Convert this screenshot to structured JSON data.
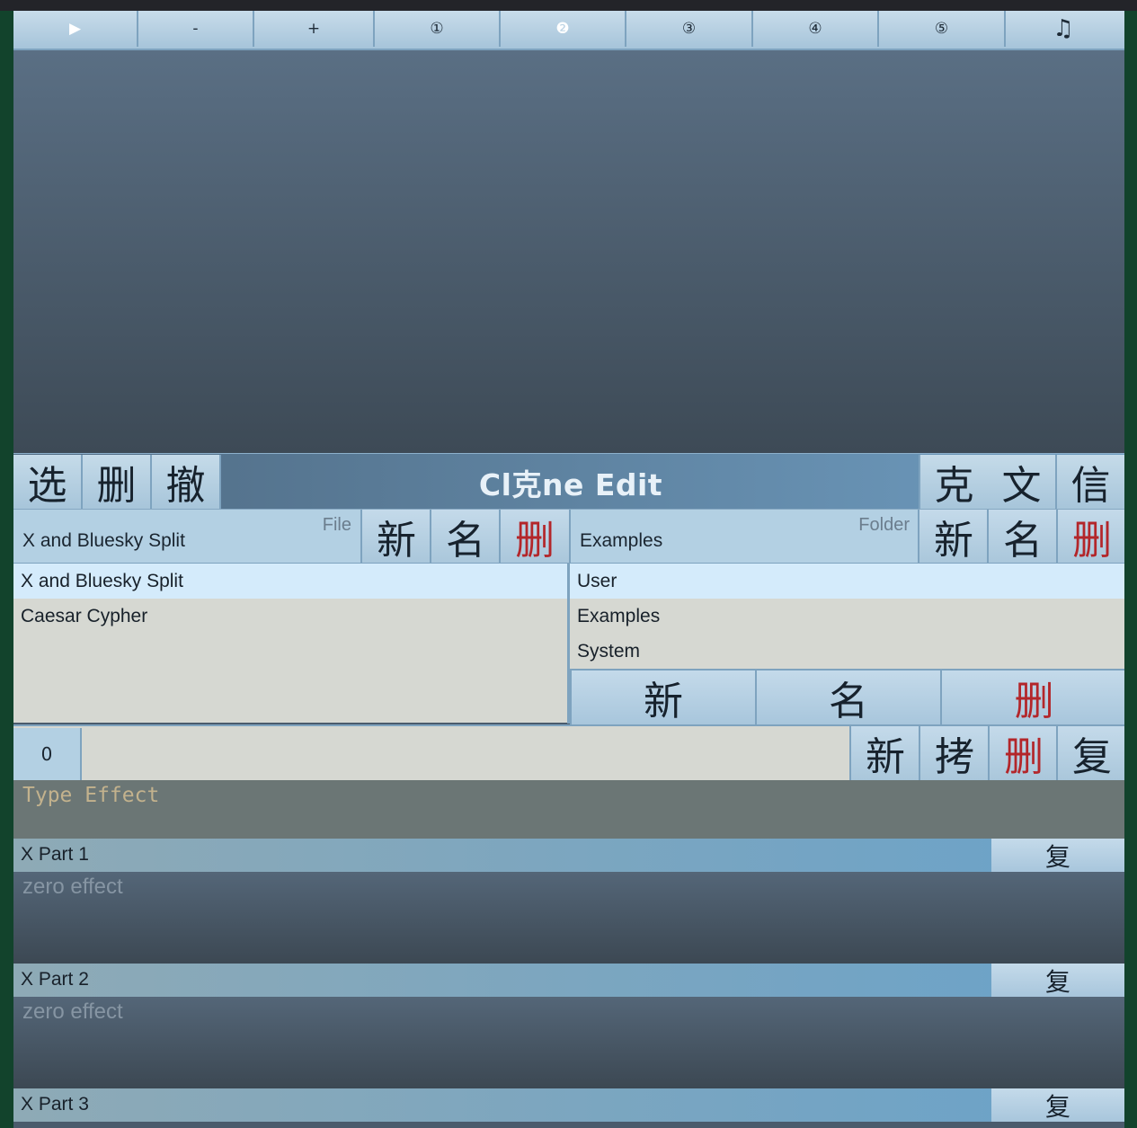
{
  "toolbar": {
    "buttons": [
      {
        "label": "▶",
        "active": true
      },
      {
        "label": "-"
      },
      {
        "label": "+"
      },
      {
        "label": "①"
      },
      {
        "label": "❷",
        "active": true
      },
      {
        "label": "③"
      },
      {
        "label": "④"
      },
      {
        "label": "⑤"
      },
      {
        "label": "♫"
      }
    ]
  },
  "header": {
    "left_buttons": [
      "选",
      "删",
      "撤"
    ],
    "title": "Cl克ne Edit",
    "right_buttons": [
      "克",
      "文",
      "信"
    ]
  },
  "file": {
    "value": "X and Bluesky Split",
    "label": "File",
    "buttons": [
      "新",
      "名",
      "删"
    ]
  },
  "folder": {
    "value": "Examples",
    "label": "Folder",
    "buttons": [
      "新",
      "名",
      "删"
    ]
  },
  "file_list": [
    "X and Bluesky Split",
    "Caesar Cypher"
  ],
  "folder_list": [
    "User",
    "Examples",
    "System"
  ],
  "folder_list_buttons": [
    "新",
    "名",
    "删"
  ],
  "part_row": {
    "index": "0",
    "buttons": [
      "新",
      "拷",
      "删",
      "复"
    ]
  },
  "effect": {
    "placeholder": "Type Effect"
  },
  "parts": [
    {
      "name": "X Part 1",
      "button": "复",
      "effect": "zero effect"
    },
    {
      "name": "X Part 2",
      "button": "复",
      "effect": "zero effect"
    },
    {
      "name": "X Part 3",
      "button": "复"
    }
  ],
  "colors": {
    "accent": "#6aa2c9",
    "delete": "#b3262a",
    "background": "#12432c"
  }
}
